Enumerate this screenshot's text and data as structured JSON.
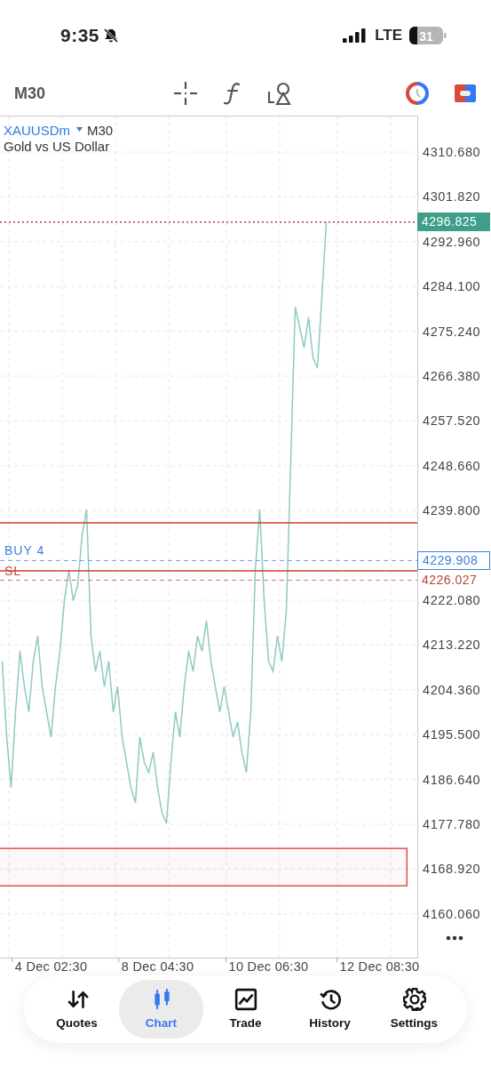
{
  "status_bar": {
    "time": "9:35",
    "network": "LTE",
    "battery": "31"
  },
  "toolbar": {
    "timeframe": "M30"
  },
  "chart": {
    "symbol": "XAUUSDm",
    "timeframe": "M30",
    "description": "Gold vs US Dollar",
    "chart_data": {
      "type": "line",
      "grid": true,
      "categories": [
        null,
        null,
        null,
        null,
        null,
        null,
        null,
        null,
        null,
        null,
        null,
        "4 Dec 02:30",
        null,
        null,
        null,
        null,
        null,
        null,
        null,
        null,
        null,
        null,
        null,
        null,
        null,
        null,
        null,
        null,
        null,
        null,
        null,
        null,
        null,
        null,
        null,
        "8 Dec 04:30",
        null,
        null,
        null,
        null,
        null,
        null,
        null,
        null,
        null,
        null,
        null,
        null,
        null,
        null,
        null,
        null,
        null,
        null,
        null,
        null,
        null,
        null,
        null,
        null,
        "10 Dec 06:30",
        null,
        null,
        null,
        null,
        null,
        null,
        null,
        null,
        null,
        null,
        null,
        null,
        null,
        null,
        null,
        null,
        null,
        null,
        null,
        null,
        null,
        null,
        null,
        null,
        "12 Dec 08:30",
        null,
        null,
        null,
        null,
        null,
        null,
        null,
        null
      ],
      "series": [
        {
          "color": "#8fcac1",
          "values": [
            4210,
            4195,
            4185,
            4200,
            4212,
            4205,
            4200,
            4210,
            4215,
            4205,
            4200,
            4195,
            4205,
            4212,
            4222,
            4228,
            4222,
            4225,
            4235,
            4240,
            4215,
            4208,
            4212,
            4205,
            4210,
            4200,
            4205,
            4195,
            4190,
            4185,
            4182,
            4195,
            4190,
            4188,
            4192,
            4185,
            4180,
            4178,
            4190,
            4200,
            4195,
            4205,
            4212,
            4208,
            4215,
            4212,
            4218,
            4210,
            4205,
            4200,
            4205,
            4200,
            4195,
            4198,
            4192,
            4188,
            4200,
            4228,
            4240,
            4222,
            4210,
            4208,
            4215,
            4210,
            4220,
            4250,
            4280,
            4276,
            4272,
            4278,
            4270,
            4268,
            4282,
            4296.8,
            null,
            null,
            null,
            null,
            null,
            null,
            null,
            null,
            null,
            null,
            null,
            null,
            null,
            null,
            null,
            null,
            null,
            null,
            null,
            null
          ]
        }
      ],
      "ylim": [
        4151.4,
        4317.89
      ],
      "yticks": [
        {
          "value": 4310.68,
          "label": "4310.680"
        },
        {
          "value": 4301.82,
          "label": "4301.820"
        },
        {
          "value": 4292.96,
          "label": "4292.960"
        },
        {
          "value": 4284.1,
          "label": "4284.100"
        },
        {
          "value": 4275.24,
          "label": "4275.240"
        },
        {
          "value": 4266.38,
          "label": "4266.380"
        },
        {
          "value": 4257.52,
          "label": "4257.520"
        },
        {
          "value": 4248.66,
          "label": "4248.660"
        },
        {
          "value": 4239.8,
          "label": "4239.800"
        },
        {
          "value": 4222.08,
          "label": "4222.080"
        },
        {
          "value": 4213.22,
          "label": "4213.220"
        },
        {
          "value": 4204.36,
          "label": "4204.360"
        },
        {
          "value": 4195.5,
          "label": "4195.500"
        },
        {
          "value": 4186.64,
          "label": "4186.640"
        },
        {
          "value": 4177.78,
          "label": "4177.780"
        },
        {
          "value": 4168.92,
          "label": "4168.920"
        },
        {
          "value": 4160.06,
          "label": "4160.060"
        }
      ],
      "ref_lines": [
        {
          "axis": "y",
          "value": 4296.825,
          "color": "#a0453a"
        },
        {
          "axis": "y",
          "value": 4237.37,
          "color": "#d63b30"
        },
        {
          "axis": "y",
          "value": 4229.908,
          "label": "BUY 4",
          "color": "#3b7fe0"
        },
        {
          "axis": "y",
          "value": 4227.87,
          "color": "#d63b30"
        },
        {
          "axis": "y",
          "value": 4226.027,
          "label": "SL",
          "color": "#b8463a"
        }
      ],
      "bands": [
        {
          "axis": "y",
          "from": 4165.6,
          "to": 4173.0,
          "color": "#d63b30"
        }
      ]
    },
    "line_tags": [
      {
        "kind": "filled",
        "text": "4296.825"
      },
      {
        "kind": "none"
      },
      {
        "kind": "boxed",
        "text": "4229.908"
      },
      {
        "kind": "none"
      },
      {
        "kind": "plain",
        "text": "4226.027"
      }
    ]
  },
  "tab_bar": [
    {
      "kind": "quotes",
      "label": "Quotes",
      "selected": false
    },
    {
      "kind": "chart",
      "label": "Chart",
      "selected": true
    },
    {
      "kind": "trade",
      "label": "Trade",
      "selected": false
    },
    {
      "kind": "history",
      "label": "History",
      "selected": false
    },
    {
      "kind": "settings",
      "label": "Settings",
      "selected": false
    }
  ]
}
